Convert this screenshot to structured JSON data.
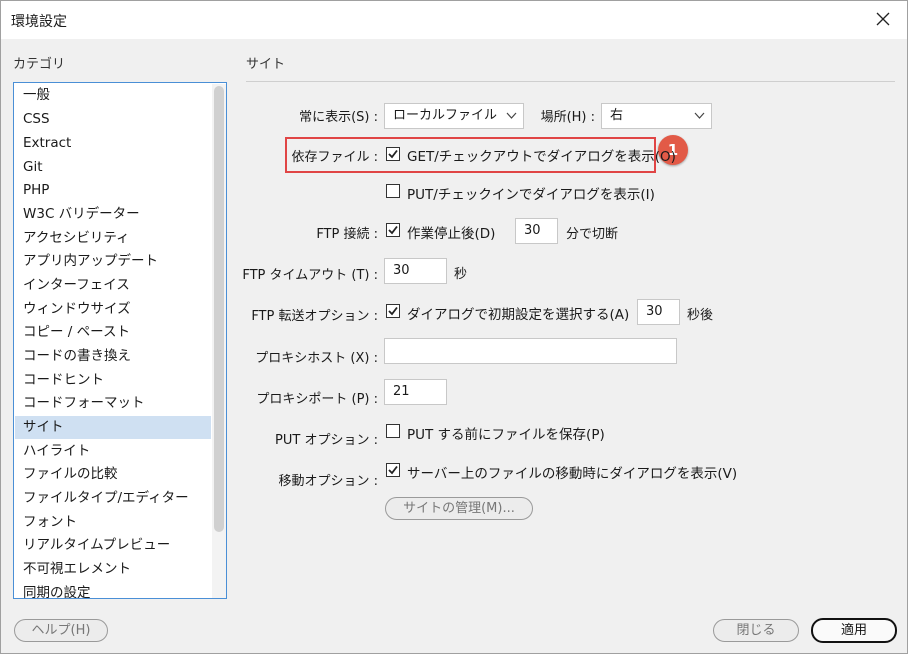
{
  "window": {
    "title": "環境設定"
  },
  "category": {
    "label": "カテゴリ",
    "items": [
      "一般",
      "CSS",
      "Extract",
      "Git",
      "PHP",
      "W3C バリデーター",
      "アクセシビリティ",
      "アプリ内アップデート",
      "インターフェイス",
      "ウィンドウサイズ",
      "コピー / ペースト",
      "コードの書き換え",
      "コードヒント",
      "コードフォーマット",
      "サイト",
      "ハイライト",
      "ファイルの比較",
      "ファイルタイプ/エディター",
      "フォント",
      "リアルタイムプレビュー",
      "不可視エレメント",
      "同期の設定"
    ],
    "selected": "サイト"
  },
  "site": {
    "label": "サイト",
    "always_show_label": "常に表示(S) :",
    "always_show_value": "ローカルファイル",
    "location_label": "場所(H) :",
    "location_value": "右",
    "dependent_label": "依存ファイル :",
    "get_dialog": {
      "label": "GET/チェックアウトでダイアログを表示(O)",
      "checked": true
    },
    "put_dialog": {
      "label": "PUT/チェックインでダイアログを表示(I)",
      "checked": false
    },
    "ftp_connection_label": "FTP 接続 :",
    "ftp_idle": {
      "label": "作業停止後(D)",
      "checked": true
    },
    "ftp_idle_value": "30",
    "ftp_idle_unit": "分で切断",
    "ftp_timeout_label": "FTP タイムアウト (T) :",
    "ftp_timeout_value": "30",
    "ftp_timeout_unit": "秒",
    "ftp_transfer_label": "FTP 転送オプション :",
    "ftp_transfer": {
      "label": "ダイアログで初期設定を選択する(A)",
      "checked": true
    },
    "ftp_transfer_value": "30",
    "ftp_transfer_unit": "秒後",
    "proxy_host_label": "プロキシホスト (X) :",
    "proxy_host_value": "",
    "proxy_port_label": "プロキシポート (P) :",
    "proxy_port_value": "21",
    "put_options_label": "PUT オプション :",
    "put_save": {
      "label": "PUT する前にファイルを保存(P)",
      "checked": false
    },
    "move_options_label": "移動オプション :",
    "move_dialog": {
      "label": "サーバー上のファイルの移動時にダイアログを表示(V)",
      "checked": true
    },
    "manage_sites_button": "サイトの管理(M)..."
  },
  "annotation": {
    "badge": "1",
    "highlight_color": "#e04545",
    "badge_color": "#e25a47"
  },
  "footer": {
    "help_button": "ヘルプ(H)",
    "close_button": "閉じる",
    "apply_button": "適用"
  },
  "colors": {
    "selection": "#cfe0f2",
    "list_border": "#4a8fd6"
  }
}
